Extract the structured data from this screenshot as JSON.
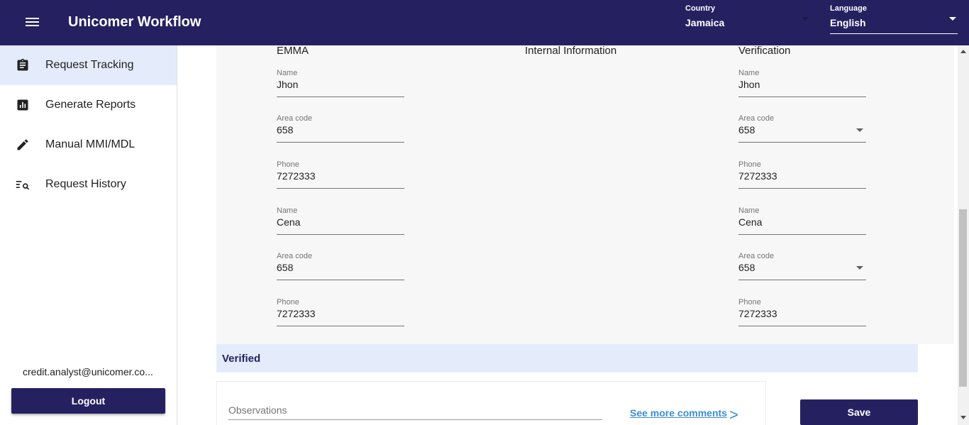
{
  "header": {
    "title": "Unicomer Workflow",
    "country_label": "Country",
    "country_value": "Jamaica",
    "language_label": "Language",
    "language_value": "English"
  },
  "sidebar": {
    "items": [
      {
        "label": "Request Tracking",
        "icon": "clipboard-icon",
        "active": true
      },
      {
        "label": "Generate Reports",
        "icon": "report-chart-icon",
        "active": false
      },
      {
        "label": "Manual MMI/MDL",
        "icon": "pencil-icon",
        "active": false
      },
      {
        "label": "Request History",
        "icon": "search-list-icon",
        "active": false
      }
    ],
    "user_email": "credit.analyst@unicomer.co...",
    "logout_label": "Logout"
  },
  "columns": {
    "emma_title": "EMMA",
    "internal_title": "Internal Information",
    "verification_title": "Verification"
  },
  "emma_fields": [
    {
      "label": "Name",
      "value": "Jhon"
    },
    {
      "label": "Area code",
      "value": "658"
    },
    {
      "label": "Phone",
      "value": "7272333"
    },
    {
      "label": "Name",
      "value": "Cena"
    },
    {
      "label": "Area code",
      "value": "658"
    },
    {
      "label": "Phone",
      "value": "7272333"
    }
  ],
  "verification_fields": [
    {
      "label": "Name",
      "value": "Jhon"
    },
    {
      "label": "Area code",
      "value": "658"
    },
    {
      "label": "Phone",
      "value": "7272333"
    },
    {
      "label": "Name",
      "value": "Cena"
    },
    {
      "label": "Area code",
      "value": "658"
    },
    {
      "label": "Phone",
      "value": "7272333"
    }
  ],
  "verified_label": "Verified",
  "observations": {
    "placeholder": "Observations",
    "see_more_label": "See more comments",
    "chevron": ">"
  },
  "save_label": "Save",
  "colors": {
    "primary": "#252161",
    "active_bg": "#e4ecfb",
    "link": "#3b8fd9"
  }
}
